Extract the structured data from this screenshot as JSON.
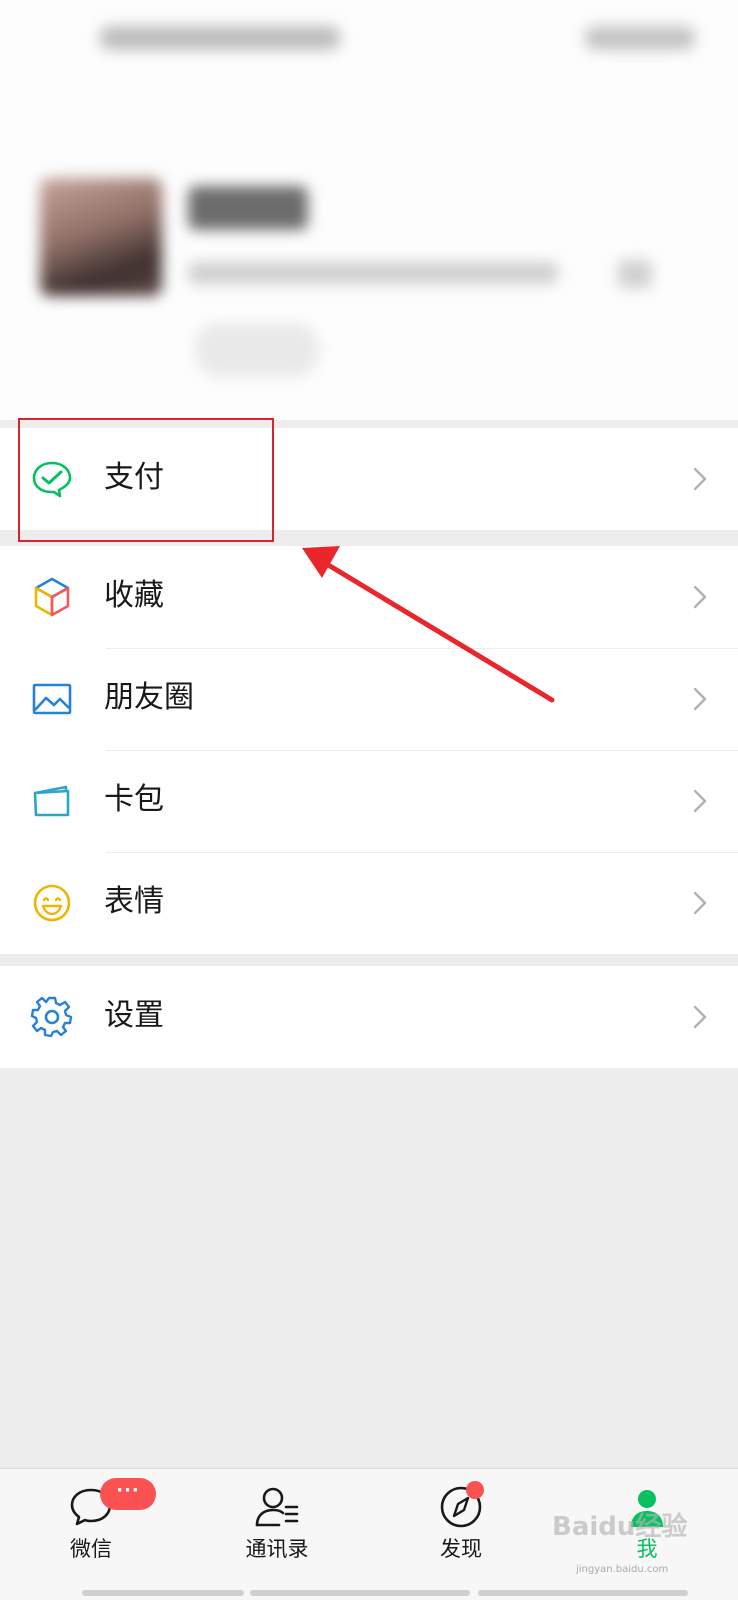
{
  "profile": {
    "name": "",
    "wechat_id": ""
  },
  "menu": {
    "pay": {
      "label": "支付",
      "icon": "wechat-pay-icon",
      "color": "#07c160"
    },
    "favorites": {
      "label": "收藏",
      "icon": "cube-icon",
      "color": "#f2b400"
    },
    "moments": {
      "label": "朋友圈",
      "icon": "image-icon",
      "color": "#2782d7"
    },
    "cards": {
      "label": "卡包",
      "icon": "card-wallet-icon",
      "color": "#2aa6c7"
    },
    "stickers": {
      "label": "表情",
      "icon": "smiley-icon",
      "color": "#f2b400"
    },
    "settings": {
      "label": "设置",
      "icon": "gear-icon",
      "color": "#2782d7"
    }
  },
  "tabbar": {
    "chats": {
      "label": "微信",
      "icon": "chat-bubble-icon",
      "badge": "···"
    },
    "contacts": {
      "label": "通讯录",
      "icon": "contacts-icon"
    },
    "discover": {
      "label": "发现",
      "icon": "compass-icon"
    },
    "me": {
      "label": "我",
      "icon": "person-icon",
      "active": true
    }
  },
  "watermark": {
    "text": "Baidu经验",
    "subtext": "jingyan.baidu.com"
  },
  "colors": {
    "accent": "#07c160",
    "badge": "#fa5151",
    "annotation": "#d9242b",
    "background": "#ededed"
  }
}
